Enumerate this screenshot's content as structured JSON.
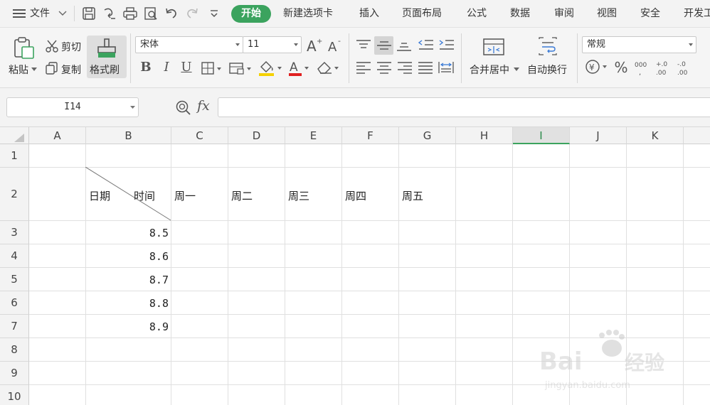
{
  "menu": {
    "file": "文件",
    "tabs": [
      "开始",
      "新建选项卡",
      "插入",
      "页面布局",
      "公式",
      "数据",
      "审阅",
      "视图",
      "安全",
      "开发工"
    ]
  },
  "ribbon": {
    "paste": "粘贴",
    "cut": "剪切",
    "copy": "复制",
    "format_painter": "格式刷",
    "font_name": "宋体",
    "font_size": "11",
    "bold": "B",
    "italic": "I",
    "underline": "U",
    "font_color_letter": "A",
    "merge_center": "合并居中",
    "wrap_text": "自动换行",
    "number_format": "常规"
  },
  "formula_bar": {
    "name_box": "I14",
    "fx": "fx",
    "value": ""
  },
  "sheet": {
    "columns": [
      "A",
      "B",
      "C",
      "D",
      "E",
      "F",
      "G",
      "H",
      "I",
      "J",
      "K"
    ],
    "selected_column": "I",
    "rows": [
      "1",
      "2",
      "3",
      "4",
      "5",
      "6",
      "7",
      "8",
      "9",
      "10"
    ],
    "header_cell": {
      "left": "日期",
      "right": "时间"
    },
    "weekdays": [
      "周一",
      "周二",
      "周三",
      "周四",
      "周五"
    ],
    "times": [
      "8.5",
      "8.6",
      "8.7",
      "8.8",
      "8.9"
    ]
  },
  "colors": {
    "accent": "#3ba35e",
    "font_color_bar": "#e02020",
    "fill_color_bar": "#f5d100"
  }
}
